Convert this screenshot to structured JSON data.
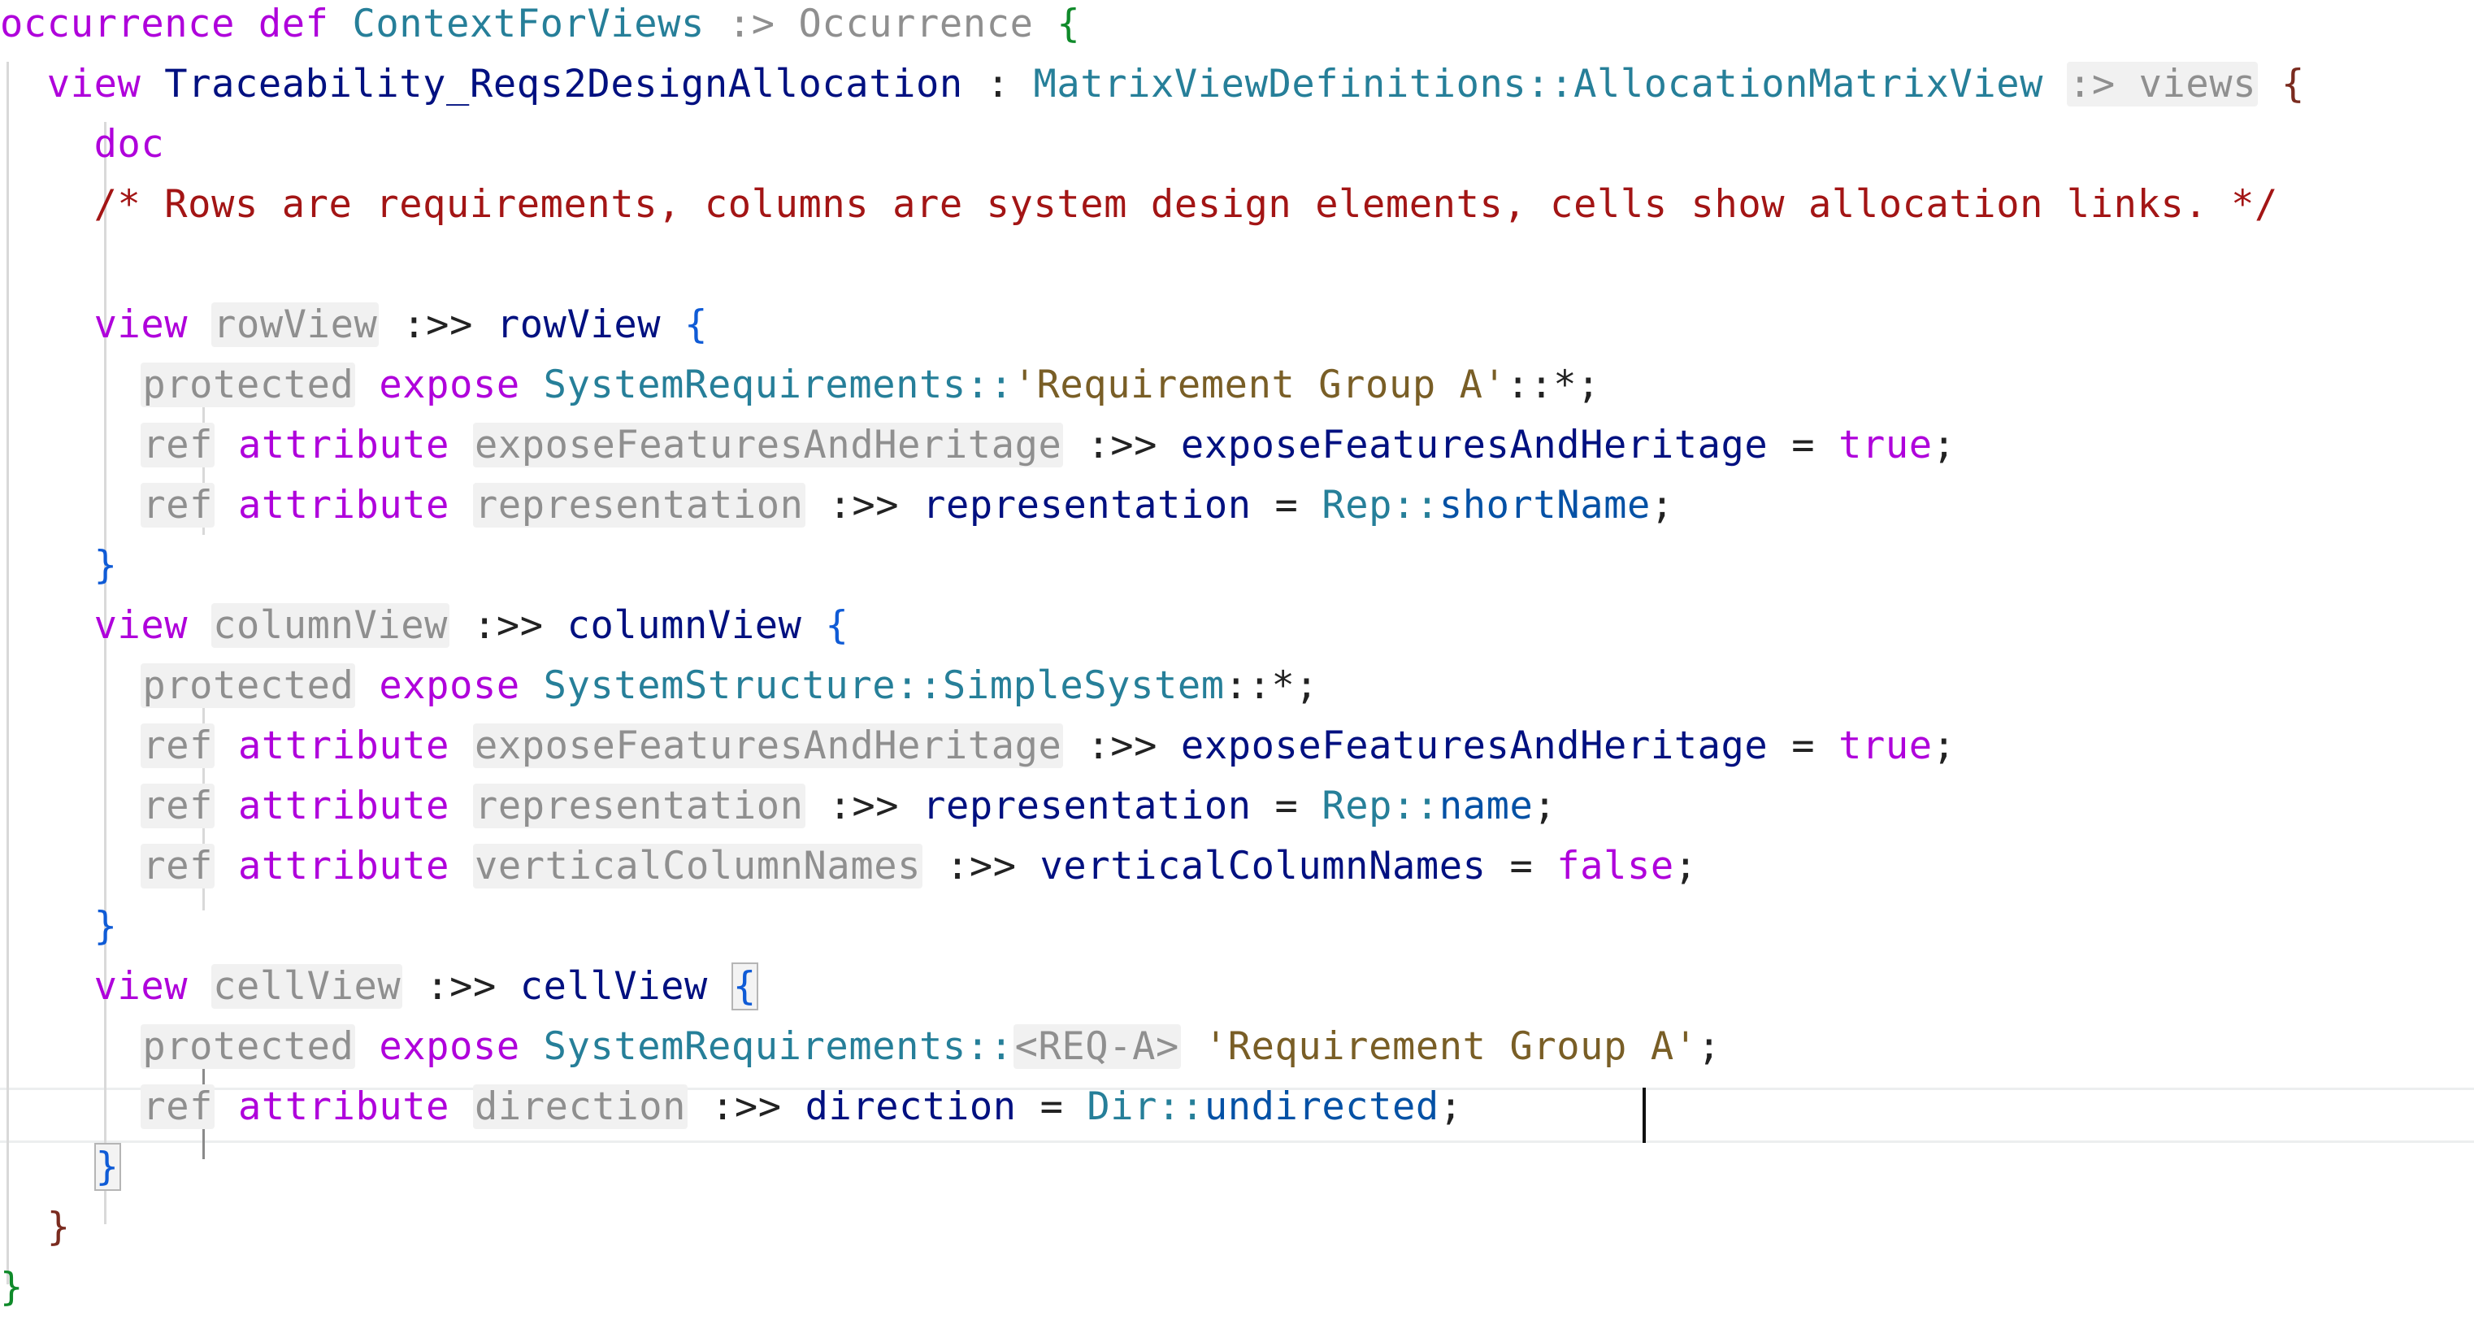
{
  "code": {
    "line1": {
      "a": "occurrence",
      "b": "def",
      "c": "ContextForViews",
      "d": ":> Occurrence",
      "e": "{"
    },
    "line2": {
      "a": "view",
      "b": "Traceability_Reqs2DesignAllocation",
      "c": ":",
      "d": "MatrixViewDefinitions::AllocationMatrixView",
      "e": ":> views",
      "f": "{"
    },
    "line3": {
      "a": "doc"
    },
    "line4": {
      "a": "/* Rows are requirements, columns are system design elements, cells show allocation links. */"
    },
    "line6": {
      "a": "view",
      "b": "rowView",
      "c": ":>>",
      "d": "rowView",
      "e": "{"
    },
    "line7": {
      "a": "protected",
      "b": "expose",
      "c": "SystemRequirements::",
      "d": "'Requirement Group A'",
      "e": "::*;"
    },
    "line8": {
      "a": "ref",
      "b": "attribute",
      "c": "exposeFeaturesAndHeritage",
      "d": ":>>",
      "e": "exposeFeaturesAndHeritage",
      "f": "=",
      "g": "true",
      "h": ";"
    },
    "line9": {
      "a": "ref",
      "b": "attribute",
      "c": "representation",
      "d": ":>>",
      "e": "representation",
      "f": "=",
      "g": "Rep::",
      "h": "shortName",
      "i": ";"
    },
    "line10": {
      "a": "}"
    },
    "line11": {
      "a": "view",
      "b": "columnView",
      "c": ":>>",
      "d": "columnView",
      "e": "{"
    },
    "line12": {
      "a": "protected",
      "b": "expose",
      "c": "SystemStructure::SimpleSystem",
      "d": "::*;"
    },
    "line13": {
      "a": "ref",
      "b": "attribute",
      "c": "exposeFeaturesAndHeritage",
      "d": ":>>",
      "e": "exposeFeaturesAndHeritage",
      "f": "=",
      "g": "true",
      "h": ";"
    },
    "line14": {
      "a": "ref",
      "b": "attribute",
      "c": "representation",
      "d": ":>>",
      "e": "representation",
      "f": "=",
      "g": "Rep::",
      "h": "name",
      "i": ";"
    },
    "line15": {
      "a": "ref",
      "b": "attribute",
      "c": "verticalColumnNames",
      "d": ":>>",
      "e": "verticalColumnNames",
      "f": "=",
      "g": "false",
      "h": ";"
    },
    "line16": {
      "a": "}"
    },
    "line17": {
      "a": "view",
      "b": "cellView",
      "c": ":>>",
      "d": "cellView",
      "e": "{"
    },
    "line18": {
      "a": "protected",
      "b": "expose",
      "c": "SystemRequirements::",
      "d": "<REQ-A>",
      "e": "'Requirement Group A'",
      "f": ";"
    },
    "line19": {
      "a": "ref",
      "b": "attribute",
      "c": "direction",
      "d": ":>>",
      "e": "direction",
      "f": "=",
      "g": "Dir::",
      "h": "undirected",
      "i": ";"
    },
    "line20": {
      "a": "}"
    },
    "line21": {
      "a": "}"
    },
    "line22": {
      "a": "}"
    }
  }
}
